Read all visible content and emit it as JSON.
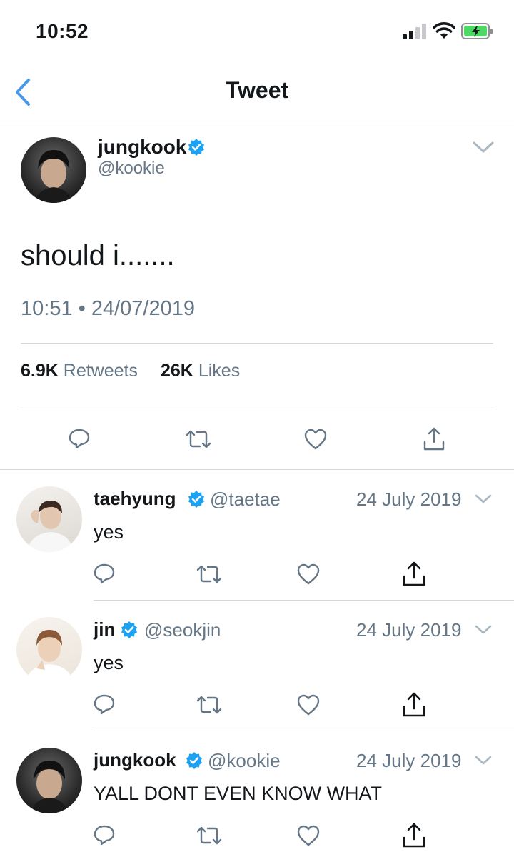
{
  "status_bar": {
    "time": "10:52",
    "icons": [
      "cellular-signal-icon",
      "wifi-icon",
      "battery-charging-icon"
    ]
  },
  "nav": {
    "title": "Tweet",
    "back_icon": "chevron-left-icon"
  },
  "main_tweet": {
    "name": "jungkook",
    "handle": "@kookie",
    "verified": true,
    "text": "should i.......",
    "timestamp": "10:51 • 24/07/2019",
    "retweets_count": "6.9K",
    "retweets_label": "Retweets",
    "likes_count": "26K",
    "likes_label": "Likes"
  },
  "replies": [
    {
      "name": "taehyung",
      "handle": "@taetae",
      "date": "24 July 2019",
      "text": "yes",
      "verified": true
    },
    {
      "name": "jin",
      "handle": "@seokjin",
      "date": "24 July 2019",
      "text": "yes",
      "verified": true
    },
    {
      "name": "jungkook",
      "handle": "@kookie",
      "date": "24 July 2019",
      "text": "YALL DONT EVEN KNOW WHAT",
      "verified": true
    }
  ],
  "colors": {
    "accent": "#4a98e9",
    "verified": "#1da1f2",
    "muted": "#657786",
    "divider": "#d3d8dc",
    "battery": "#4cd964"
  }
}
